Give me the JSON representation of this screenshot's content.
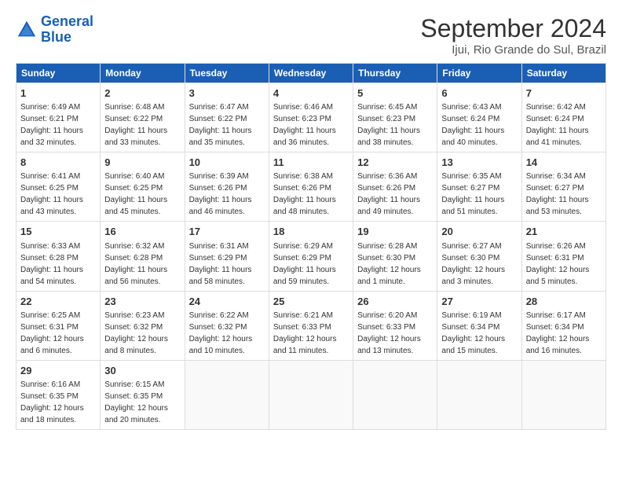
{
  "logo": {
    "line1": "General",
    "line2": "Blue"
  },
  "title": "September 2024",
  "subtitle": "Ijui, Rio Grande do Sul, Brazil",
  "days_of_week": [
    "Sunday",
    "Monday",
    "Tuesday",
    "Wednesday",
    "Thursday",
    "Friday",
    "Saturday"
  ],
  "weeks": [
    [
      {
        "day": "1",
        "sunrise": "6:49 AM",
        "sunset": "6:21 PM",
        "daylight": "11 hours and 32 minutes."
      },
      {
        "day": "2",
        "sunrise": "6:48 AM",
        "sunset": "6:22 PM",
        "daylight": "11 hours and 33 minutes."
      },
      {
        "day": "3",
        "sunrise": "6:47 AM",
        "sunset": "6:22 PM",
        "daylight": "11 hours and 35 minutes."
      },
      {
        "day": "4",
        "sunrise": "6:46 AM",
        "sunset": "6:23 PM",
        "daylight": "11 hours and 36 minutes."
      },
      {
        "day": "5",
        "sunrise": "6:45 AM",
        "sunset": "6:23 PM",
        "daylight": "11 hours and 38 minutes."
      },
      {
        "day": "6",
        "sunrise": "6:43 AM",
        "sunset": "6:24 PM",
        "daylight": "11 hours and 40 minutes."
      },
      {
        "day": "7",
        "sunrise": "6:42 AM",
        "sunset": "6:24 PM",
        "daylight": "11 hours and 41 minutes."
      }
    ],
    [
      {
        "day": "8",
        "sunrise": "6:41 AM",
        "sunset": "6:25 PM",
        "daylight": "11 hours and 43 minutes."
      },
      {
        "day": "9",
        "sunrise": "6:40 AM",
        "sunset": "6:25 PM",
        "daylight": "11 hours and 45 minutes."
      },
      {
        "day": "10",
        "sunrise": "6:39 AM",
        "sunset": "6:26 PM",
        "daylight": "11 hours and 46 minutes."
      },
      {
        "day": "11",
        "sunrise": "6:38 AM",
        "sunset": "6:26 PM",
        "daylight": "11 hours and 48 minutes."
      },
      {
        "day": "12",
        "sunrise": "6:36 AM",
        "sunset": "6:26 PM",
        "daylight": "11 hours and 49 minutes."
      },
      {
        "day": "13",
        "sunrise": "6:35 AM",
        "sunset": "6:27 PM",
        "daylight": "11 hours and 51 minutes."
      },
      {
        "day": "14",
        "sunrise": "6:34 AM",
        "sunset": "6:27 PM",
        "daylight": "11 hours and 53 minutes."
      }
    ],
    [
      {
        "day": "15",
        "sunrise": "6:33 AM",
        "sunset": "6:28 PM",
        "daylight": "11 hours and 54 minutes."
      },
      {
        "day": "16",
        "sunrise": "6:32 AM",
        "sunset": "6:28 PM",
        "daylight": "11 hours and 56 minutes."
      },
      {
        "day": "17",
        "sunrise": "6:31 AM",
        "sunset": "6:29 PM",
        "daylight": "11 hours and 58 minutes."
      },
      {
        "day": "18",
        "sunrise": "6:29 AM",
        "sunset": "6:29 PM",
        "daylight": "11 hours and 59 minutes."
      },
      {
        "day": "19",
        "sunrise": "6:28 AM",
        "sunset": "6:30 PM",
        "daylight": "12 hours and 1 minute."
      },
      {
        "day": "20",
        "sunrise": "6:27 AM",
        "sunset": "6:30 PM",
        "daylight": "12 hours and 3 minutes."
      },
      {
        "day": "21",
        "sunrise": "6:26 AM",
        "sunset": "6:31 PM",
        "daylight": "12 hours and 5 minutes."
      }
    ],
    [
      {
        "day": "22",
        "sunrise": "6:25 AM",
        "sunset": "6:31 PM",
        "daylight": "12 hours and 6 minutes."
      },
      {
        "day": "23",
        "sunrise": "6:23 AM",
        "sunset": "6:32 PM",
        "daylight": "12 hours and 8 minutes."
      },
      {
        "day": "24",
        "sunrise": "6:22 AM",
        "sunset": "6:32 PM",
        "daylight": "12 hours and 10 minutes."
      },
      {
        "day": "25",
        "sunrise": "6:21 AM",
        "sunset": "6:33 PM",
        "daylight": "12 hours and 11 minutes."
      },
      {
        "day": "26",
        "sunrise": "6:20 AM",
        "sunset": "6:33 PM",
        "daylight": "12 hours and 13 minutes."
      },
      {
        "day": "27",
        "sunrise": "6:19 AM",
        "sunset": "6:34 PM",
        "daylight": "12 hours and 15 minutes."
      },
      {
        "day": "28",
        "sunrise": "6:17 AM",
        "sunset": "6:34 PM",
        "daylight": "12 hours and 16 minutes."
      }
    ],
    [
      {
        "day": "29",
        "sunrise": "6:16 AM",
        "sunset": "6:35 PM",
        "daylight": "12 hours and 18 minutes."
      },
      {
        "day": "30",
        "sunrise": "6:15 AM",
        "sunset": "6:35 PM",
        "daylight": "12 hours and 20 minutes."
      },
      null,
      null,
      null,
      null,
      null
    ]
  ]
}
